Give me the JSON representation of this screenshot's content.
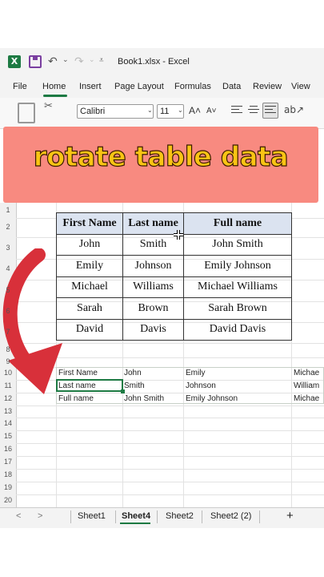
{
  "app": {
    "title": "Book1.xlsx  -  Excel",
    "excel_logo": "X",
    "undo_icon": "↶",
    "redo_icon": "↷",
    "dropdown_glyph": "⌄",
    "more_glyph": "⩡"
  },
  "ribbon_tabs": [
    "File",
    "Home",
    "Insert",
    "Page Layout",
    "Formulas",
    "Data",
    "Review",
    "View"
  ],
  "ribbon": {
    "font_name": "Calibri",
    "font_size": "11",
    "grow_font": "A˄",
    "shrink_font": "A˅",
    "cut_icon": "✂",
    "orientation_icon": "ab↗"
  },
  "banner": {
    "text": "rotate table data",
    "fill_color": "#f88a80",
    "text_color": "#f9c414"
  },
  "row_numbers": [
    "1",
    "2",
    "3",
    "4",
    "5",
    "6",
    "7",
    "8",
    "9",
    "10",
    "11",
    "12",
    "13",
    "14",
    "15",
    "16",
    "17",
    "18",
    "19",
    "20"
  ],
  "table": {
    "headers": [
      "First Name",
      "Last name",
      "Full name"
    ],
    "rows": [
      [
        "John",
        "Smith",
        "John Smith"
      ],
      [
        "Emily",
        "Johnson",
        "Emily Johnson"
      ],
      [
        "Michael",
        "Williams",
        "Michael Williams"
      ],
      [
        "Sarah",
        "Brown",
        "Sarah Brown"
      ],
      [
        "David",
        "Davis",
        "David Davis"
      ]
    ]
  },
  "transposed": {
    "rows": [
      [
        "First Name",
        "John",
        "Emily",
        "Michae"
      ],
      [
        "Last name",
        "Smith",
        "Johnson",
        "William"
      ],
      [
        "Full name",
        "John Smith",
        "Emily Johnson",
        "Michae"
      ]
    ]
  },
  "sheet_tabs": {
    "prev_glyph": "<",
    "next_glyph": ">",
    "tabs": [
      "Sheet1",
      "Sheet4",
      "Sheet2",
      "Sheet2 (2)"
    ],
    "active": "Sheet4",
    "add_glyph": "+"
  },
  "colors": {
    "accent": "#1d7a43",
    "header_fill": "#dbe3f0",
    "arrow": "#d8303a"
  }
}
